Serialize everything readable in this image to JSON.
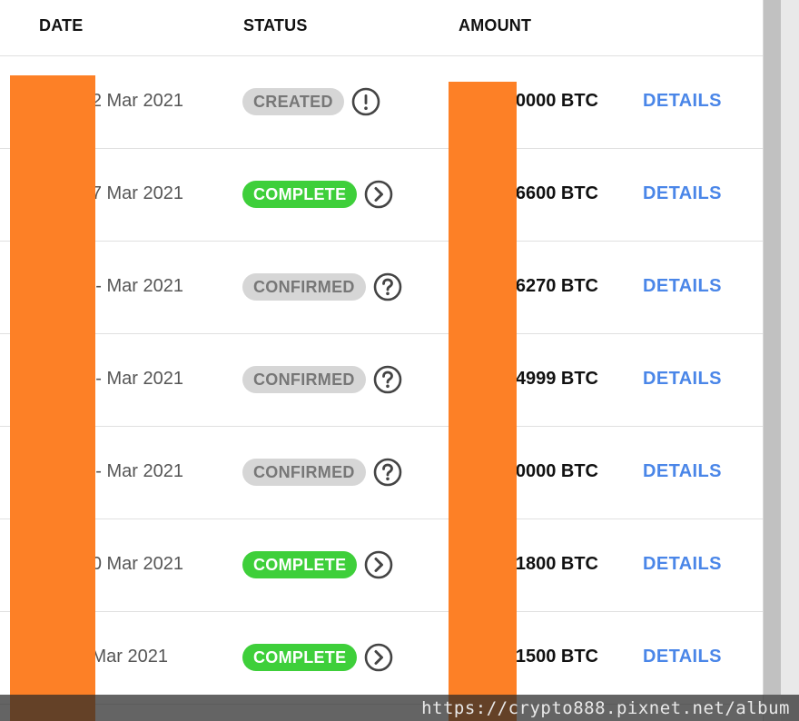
{
  "table": {
    "headers": {
      "date": "DATE",
      "status": "STATUS",
      "amount": "AMOUNT"
    },
    "details_label": "DETAILS",
    "rows": [
      {
        "date": "2 Mar 2021",
        "status": "CREATED",
        "status_color": "grey",
        "status_icon": "exclamation-circle-icon",
        "amount": "0000 BTC"
      },
      {
        "date": "7 Mar 2021",
        "status": "COMPLETE",
        "status_color": "green",
        "status_icon": "chevron-right-circle-icon",
        "amount": "6600 BTC"
      },
      {
        "date": "- Mar 2021",
        "status": "CONFIRMED",
        "status_color": "grey",
        "status_icon": "question-circle-icon",
        "amount": "6270 BTC"
      },
      {
        "date": "- Mar 2021",
        "status": "CONFIRMED",
        "status_color": "grey",
        "status_icon": "question-circle-icon",
        "amount": "4999 BTC"
      },
      {
        "date": "- Mar 2021",
        "status": "CONFIRMED",
        "status_color": "grey",
        "status_icon": "question-circle-icon",
        "amount": "0000 BTC"
      },
      {
        "date": "0 Mar 2021",
        "status": "COMPLETE",
        "status_color": "green",
        "status_icon": "chevron-right-circle-icon",
        "amount": "1800 BTC"
      },
      {
        "date": "Mar 2021",
        "status": "COMPLETE",
        "status_color": "green",
        "status_icon": "chevron-right-circle-icon",
        "amount": "1500 BTC"
      }
    ]
  },
  "colors": {
    "complete_badge": "#3ecf3a",
    "neutral_badge": "#d6d6d6",
    "details_link": "#4a86e8",
    "redaction": "#fd8026"
  },
  "watermark": "https://crypto888.pixnet.net/album"
}
